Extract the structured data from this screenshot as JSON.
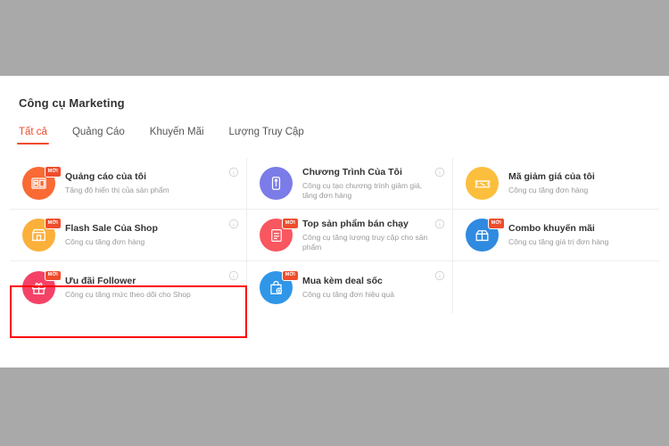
{
  "page": {
    "title": "Công cụ Marketing"
  },
  "tabs": [
    {
      "label": "Tất cả",
      "active": true
    },
    {
      "label": "Quảng Cáo",
      "active": false
    },
    {
      "label": "Khuyến Mãi",
      "active": false
    },
    {
      "label": "Lượng Truy Cập",
      "active": false
    }
  ],
  "cards": [
    {
      "title": "Quảng cáo của tôi",
      "desc": "Tăng độ hiển thị của sản phẩm",
      "badge": "MỚI",
      "icon": "ads-board-icon",
      "icon_color": "#f96a34",
      "info": "info-icon",
      "highlighted": false
    },
    {
      "title": "Chương Trình Của Tôi",
      "desc": "Công cụ tạo chương trình giảm giá, tăng đơn hàng",
      "badge": "",
      "icon": "price-tag-icon",
      "icon_color": "#7b7ce8",
      "info": "info-icon",
      "highlighted": false
    },
    {
      "title": "Mã giảm giá của tôi",
      "desc": "Công cụ tăng đơn hàng",
      "badge": "",
      "icon": "voucher-ticket-icon",
      "icon_color": "#fbbf3d",
      "info": "",
      "highlighted": false
    },
    {
      "title": "Flash Sale Của Shop",
      "desc": "Công cụ tăng đơn hàng",
      "badge": "MỚI",
      "icon": "shop-store-icon",
      "icon_color": "#fbb03b",
      "info": "info-icon",
      "highlighted": false
    },
    {
      "title": "Top sản phẩm bán chạy",
      "desc": "Công cụ tăng lượng truy cập cho sản phẩm",
      "badge": "MỚI",
      "icon": "ranking-list-icon",
      "icon_color": "#f8575f",
      "info": "info-icon",
      "highlighted": false
    },
    {
      "title": "Combo khuyến mãi",
      "desc": "Công cụ tăng giá trị đơn hàng",
      "badge": "MỚI",
      "icon": "combo-box-icon",
      "icon_color": "#2f8ae0",
      "info": "",
      "highlighted": false
    },
    {
      "title": "Ưu đãi Follower",
      "desc": "Công cụ tăng mức theo dõi cho Shop",
      "badge": "MỚI",
      "icon": "gift-icon",
      "icon_color": "#f44267",
      "info": "info-icon",
      "highlighted": true
    },
    {
      "title": "Mua kèm deal sốc",
      "desc": "Công cụ tăng đơn hiệu quả",
      "badge": "MỚI",
      "icon": "add-to-bag-icon",
      "icon_color": "#2f96e8",
      "info": "info-icon",
      "highlighted": false
    }
  ],
  "colors": {
    "accent": "#ee4d2d",
    "highlight_border": "#ff0000",
    "page_background": "#a9a9a9",
    "panel_background": "#ffffff"
  }
}
